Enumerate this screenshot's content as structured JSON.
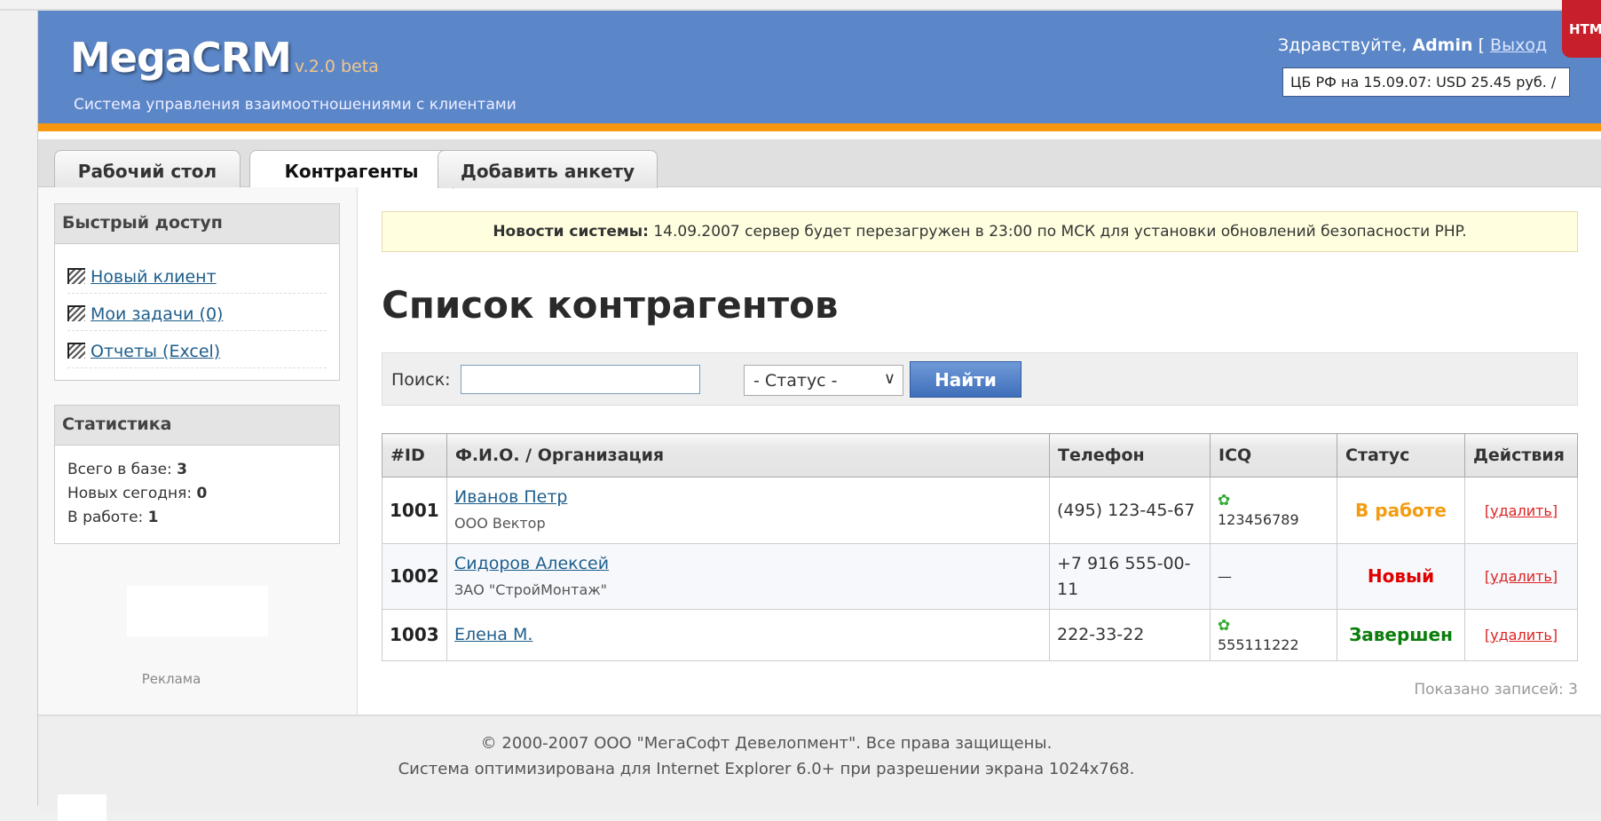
{
  "header": {
    "logo": "MegaCRM",
    "version": "v.2.0 beta",
    "subtitle": "Система управления взаимоотношениями с клиентами",
    "greeting": "Здравствуйте,",
    "user": "Admin",
    "bracket": "[",
    "logout": "Выход",
    "rate": "ЦБ РФ на 15.09.07: USD 25.45 руб. /",
    "badge": "HTML"
  },
  "tabs": [
    {
      "label": "Рабочий стол"
    },
    {
      "label": "Контрагенты"
    },
    {
      "label": "Добавить анкету"
    }
  ],
  "sidebar": {
    "quick_title": "Быстрый доступ",
    "quick_links": [
      {
        "label": "Новый клиент"
      },
      {
        "label": "Мои задачи (0)"
      },
      {
        "label": "Отчеты (Excel)"
      }
    ],
    "stats_title": "Статистика",
    "stats": [
      {
        "label": "Всего в базе:",
        "value": "3"
      },
      {
        "label": "Новых сегодня:",
        "value": "0"
      },
      {
        "label": "В работе:",
        "value": "1"
      }
    ],
    "ad_label": "Реклама"
  },
  "main": {
    "news_label": "Новости системы:",
    "news_text": "14.09.2007 сервер будет перезагружен в 23:00 по МСК для установки обновлений безопасности PHP.",
    "title": "Список контрагентов",
    "search": {
      "label": "Поиск:",
      "value": "",
      "status_selected": "- Статус -",
      "button": "Найти"
    },
    "columns": [
      "#ID",
      "Ф.И.О. / Организация",
      "Телефон",
      "ICQ",
      "Статус",
      "Действия"
    ],
    "rows": [
      {
        "id": "1001",
        "name": "Иванов Петр",
        "org": "ООО Вектор",
        "phone": "(495) 123-45-67",
        "icq": "123456789",
        "status": "В работе",
        "status_color": "#f39c12",
        "action": "[удалить]"
      },
      {
        "id": "1002",
        "name": "Сидоров Алексей",
        "org": "ЗАО \"СтройМонтаж\"",
        "phone": "+7 916 555-00-11",
        "icq": "—",
        "status": "Новый",
        "status_color": "#e00000",
        "action": "[удалить]"
      },
      {
        "id": "1003",
        "name": "Елена М.",
        "org": "",
        "phone": "222-33-22",
        "icq": "555111222",
        "status": "Завершен",
        "status_color": "#0a7d0a",
        "action": "[удалить]"
      }
    ],
    "count": "Показано записей: 3"
  },
  "footer": {
    "line1": "© 2000-2007 ООО \"МегаСофт Девелопмент\". Все права защищены.",
    "line2": "Система оптимизирована для Internet Explorer 6.0+ при разрешении экрана 1024x768."
  }
}
